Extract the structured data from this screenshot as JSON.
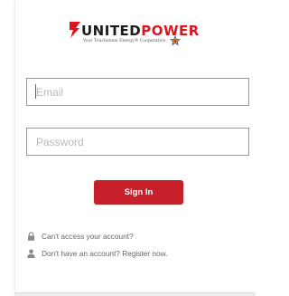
{
  "brand": {
    "name_part1": "UNITED",
    "name_part2": "POWER",
    "tagline": "Your Touchstone Energy® Cooperative",
    "colors": {
      "accent": "#c8202a",
      "dark": "#1b1b1b"
    }
  },
  "login_form": {
    "email": {
      "placeholder": "Email",
      "value": ""
    },
    "password": {
      "placeholder": "Password",
      "value": ""
    },
    "submit_label": "Sign In"
  },
  "links": {
    "access": {
      "icon": "lock-icon",
      "label": "Can't access your account?"
    },
    "register": {
      "icon": "user-icon",
      "label": "Don't have an account? Register now."
    }
  }
}
